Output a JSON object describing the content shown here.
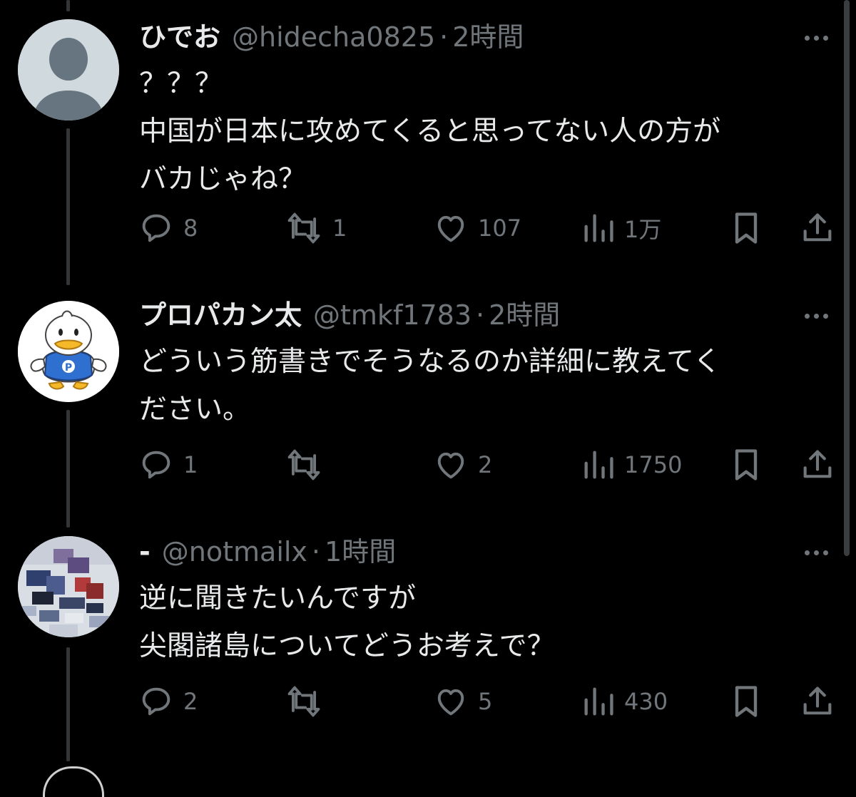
{
  "tweets": [
    {
      "name": "ひでお",
      "handle": "@hidecha0825",
      "separator": "·",
      "time": "2時間",
      "lines": [
        "？？？",
        "中国が日本に攻めてくると思ってない人の方が",
        "バカじゃね？"
      ],
      "replies": "8",
      "retweets": "1",
      "likes": "107",
      "views": "1万",
      "avatar_icon": "default-person-icon"
    },
    {
      "name": "プロパカン太",
      "handle": "@tmkf1783",
      "separator": "·",
      "time": "2時間",
      "lines": [
        "どういう筋書きでそうなるのか詳細に教えてく",
        "ださい。"
      ],
      "replies": "1",
      "retweets": "",
      "likes": "2",
      "views": "1750",
      "avatar_icon": "duck-mascot-icon"
    },
    {
      "name": "-",
      "handle": "@notmailx",
      "separator": "·",
      "time": "1時間",
      "lines": [
        "逆に聞きたいんですが",
        "尖閣諸島についてどうお考えで？"
      ],
      "replies": "2",
      "retweets": "",
      "likes": "5",
      "views": "430",
      "avatar_icon": "pixel-art-icon"
    }
  ],
  "colors": {
    "background": "#000000",
    "primary_text": "#e7e9ea",
    "secondary_text": "#71767b",
    "thread_line": "#333639"
  }
}
